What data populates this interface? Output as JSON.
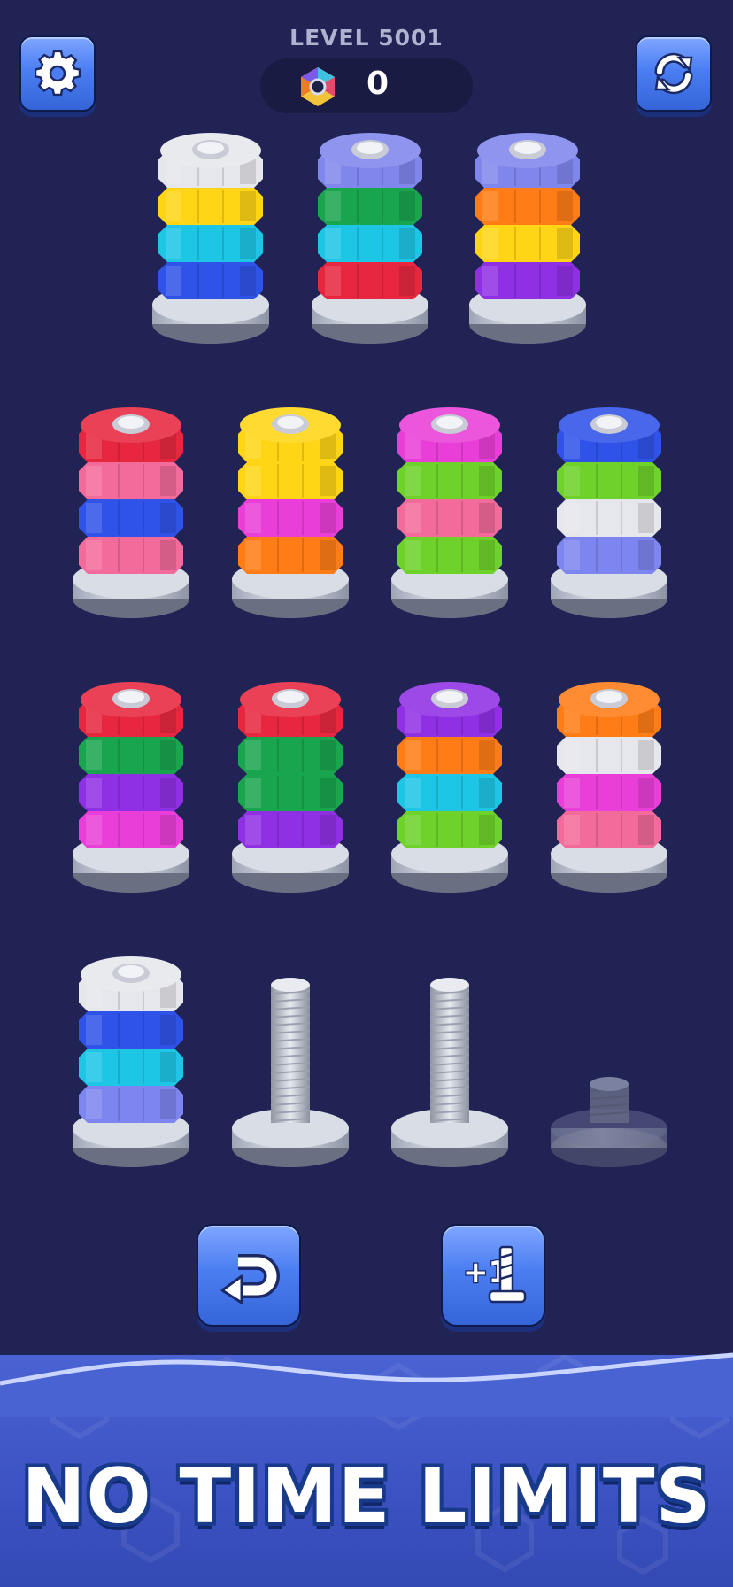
{
  "header": {
    "level_label": "LEVEL 5001",
    "score": "0",
    "settings_icon": "gear-icon",
    "refresh_icon": "refresh-icon",
    "score_icon": "hex-nut-icon"
  },
  "colors": {
    "white": "#e6e7ec",
    "yellow": "#ffd515",
    "cyan": "#1ec6e6",
    "blue": "#2f52e8",
    "lavender": "#8087ec",
    "green": "#19a54e",
    "red": "#e7273f",
    "orange": "#ff7c16",
    "purple": "#9030e4",
    "pink": "#f36b9a",
    "magenta": "#e93fd8",
    "lime": "#6ed22a",
    "periwinkle": "#7d85f0"
  },
  "rows": [
    {
      "poles": [
        {
          "nuts": [
            "blue",
            "cyan",
            "yellow",
            "white"
          ]
        },
        {
          "nuts": [
            "red",
            "cyan",
            "green",
            "lavender"
          ]
        },
        {
          "nuts": [
            "purple",
            "yellow",
            "orange",
            "lavender"
          ]
        }
      ]
    },
    {
      "poles": [
        {
          "nuts": [
            "pink",
            "blue",
            "pink",
            "red"
          ]
        },
        {
          "nuts": [
            "orange",
            "magenta",
            "yellow",
            "yellow"
          ]
        },
        {
          "nuts": [
            "lime",
            "pink",
            "lime",
            "magenta"
          ]
        },
        {
          "nuts": [
            "periwinkle",
            "white",
            "lime",
            "blue"
          ]
        }
      ]
    },
    {
      "poles": [
        {
          "nuts": [
            "magenta",
            "purple",
            "green",
            "red"
          ]
        },
        {
          "nuts": [
            "purple",
            "green",
            "green",
            "red"
          ]
        },
        {
          "nuts": [
            "lime",
            "cyan",
            "orange",
            "purple"
          ]
        },
        {
          "nuts": [
            "pink",
            "magenta",
            "white",
            "orange"
          ]
        }
      ]
    },
    {
      "poles": [
        {
          "nuts": [
            "periwinkle",
            "cyan",
            "blue",
            "white"
          ]
        },
        {
          "nuts": []
        },
        {
          "nuts": []
        },
        {
          "nuts": [],
          "locked": true
        }
      ]
    }
  ],
  "controls": {
    "undo_icon": "undo-arrow-icon",
    "add_screw_icon": "add-screw-icon",
    "add_screw_text": "+1"
  },
  "footer": {
    "tagline": "NO TIME LIMITS"
  }
}
